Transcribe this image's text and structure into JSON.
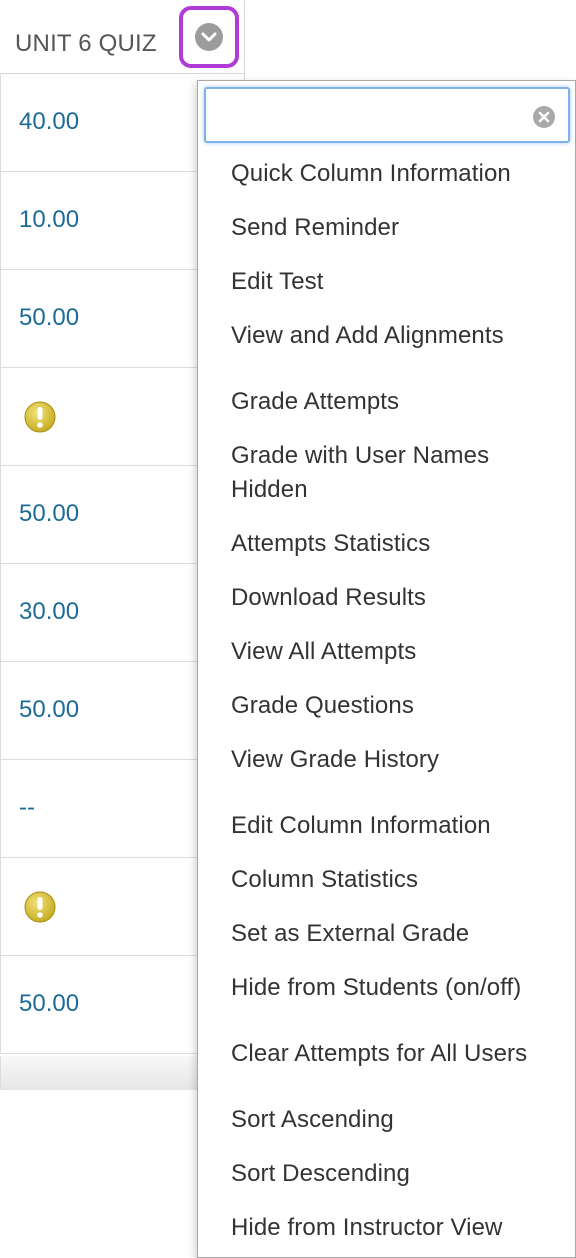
{
  "header": {
    "column_title": "UNIT 6 QUIZ",
    "menu_button_icon": "chevron-down-icon",
    "highlight_color": "#b23ad6"
  },
  "grades": [
    {
      "value": "40.00",
      "type": "score"
    },
    {
      "value": "10.00",
      "type": "score"
    },
    {
      "value": "50.00",
      "type": "score"
    },
    {
      "value": "",
      "type": "needs-grading",
      "icon": "exclamation-icon"
    },
    {
      "value": "50.00",
      "type": "score"
    },
    {
      "value": "30.00",
      "type": "score"
    },
    {
      "value": "50.00",
      "type": "score"
    },
    {
      "value": "--",
      "type": "score"
    },
    {
      "value": "",
      "type": "needs-grading",
      "icon": "exclamation-icon"
    },
    {
      "value": "50.00",
      "type": "score"
    }
  ],
  "menu": {
    "search": {
      "value": "",
      "placeholder": "",
      "clear_icon": "clear-icon"
    },
    "items": [
      "Quick Column Information",
      "Send Reminder",
      "Edit Test",
      "View and Add Alignments",
      "Grade Attempts",
      "Grade with User Names Hidden",
      "Attempts Statistics",
      "Download Results",
      "View All Attempts",
      "Grade Questions",
      "View Grade History",
      "Edit Column Information",
      "Column Statistics",
      "Set as External Grade",
      "Hide from Students (on/off)",
      "Clear Attempts for All Users",
      "Sort Ascending",
      "Sort Descending",
      "Hide from Instructor View"
    ]
  },
  "colors": {
    "link": "#1d6b94",
    "warning": "#c9b42c",
    "search_focus": "#7fb2ea"
  }
}
